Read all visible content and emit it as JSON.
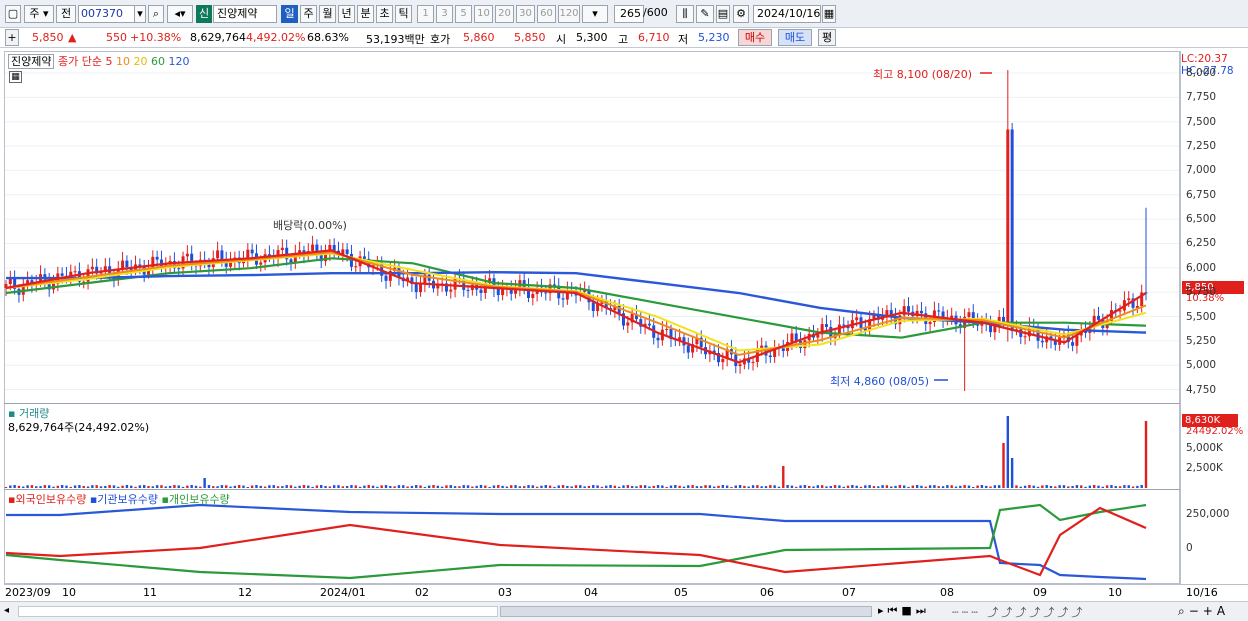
{
  "toolbar": {
    "period_label": "주",
    "prev_label": "전",
    "code": "007370",
    "badge": "신",
    "stock_name": "진양제약",
    "periods": [
      "일",
      "주",
      "월",
      "년",
      "분",
      "초",
      "틱"
    ],
    "intervals": [
      "1",
      "3",
      "5",
      "10",
      "20",
      "30",
      "60",
      "120"
    ],
    "count": "265",
    "count_max": "/600",
    "date": "2024/10/16"
  },
  "info": {
    "price": "5,850",
    "change": "550",
    "change_pct": "+10.38%",
    "volume": "8,629,764",
    "volume_pct": "4,492.02%",
    "turnover": "68.63%",
    "amount": "53,193백만",
    "quote_label": "호가",
    "ask": "5,860",
    "bid": "5,850",
    "open_label": "시",
    "open": "5,300",
    "high_label": "고",
    "high": "6,710",
    "low_label": "저",
    "low": "5,230",
    "buy_label": "매수",
    "sell_label": "매도",
    "avg_label": "평"
  },
  "price_panel": {
    "stock_label": "진양제약",
    "ma_label": "종가 단순 5",
    "ma_periods": [
      "10",
      "20",
      "60",
      "120"
    ],
    "lc_label": "LC:20.37",
    "hc_label": "HC:-27.78",
    "high_annotation": "최고 8,100 (08/20)",
    "low_annotation": "최저 4,860 (08/05)",
    "dividend_annotation": "배당락(0.00%)",
    "current_flag": "5,850",
    "change_flag": "10.38%",
    "y_ticks": [
      "8,000",
      "7,750",
      "7,500",
      "7,250",
      "7,000",
      "6,750",
      "6,500",
      "6,250",
      "6,000",
      "5,750",
      "5,500",
      "5,250",
      "5,000",
      "4,750"
    ]
  },
  "volume_panel": {
    "title": "거래량",
    "value_text": "8,629,764주(24,492.02%)",
    "flag_value": "8,630K",
    "flag_pct": "24492.02%",
    "y_ticks": [
      "5,000K",
      "2,500K"
    ]
  },
  "holdings_panel": {
    "foreign_label": "외국인보유수량",
    "inst_label": "기관보유수량",
    "indiv_label": "개인보유수량",
    "y_ticks": [
      "250,000",
      "0"
    ]
  },
  "x_axis": {
    "labels": [
      "2023/09",
      "10",
      "11",
      "12",
      "2024/01",
      "02",
      "03",
      "04",
      "05",
      "06",
      "07",
      "08",
      "09",
      "10",
      "10/16"
    ]
  },
  "colors": {
    "up": "#e0201c",
    "down": "#1f4fd8",
    "ma5": "#e0201c",
    "ma10": "#f08a1c",
    "ma20": "#f2e21a",
    "ma60": "#2a9a3a",
    "ma120": "#2a58d8"
  },
  "chart_data": {
    "type": "line",
    "x": [
      "2023/09",
      "2023/10",
      "2023/11",
      "2023/12",
      "2024/01",
      "2024/02",
      "2024/03",
      "2024/04",
      "2024/05",
      "2024/06",
      "2024/07",
      "2024/08",
      "2024/09",
      "2024/10",
      "2024/10/16"
    ],
    "series": [
      {
        "name": "종가",
        "values": [
          5900,
          6050,
          6150,
          6200,
          6280,
          5950,
          5900,
          5850,
          5450,
          5150,
          5450,
          5650,
          5550,
          5350,
          5850
        ]
      },
      {
        "name": "120",
        "values": [
          6000,
          6000,
          6020,
          6030,
          6050,
          6050,
          6060,
          6050,
          5950,
          5850,
          5700,
          5600,
          5550,
          5480,
          5450
        ]
      },
      {
        "name": "60",
        "values": [
          5850,
          5950,
          6050,
          6100,
          6200,
          6150,
          5950,
          5900,
          5750,
          5600,
          5450,
          5400,
          5550,
          5550,
          5520
        ]
      }
    ],
    "ylim": [
      4750,
      8100
    ],
    "high": 8100,
    "low": 4860
  }
}
